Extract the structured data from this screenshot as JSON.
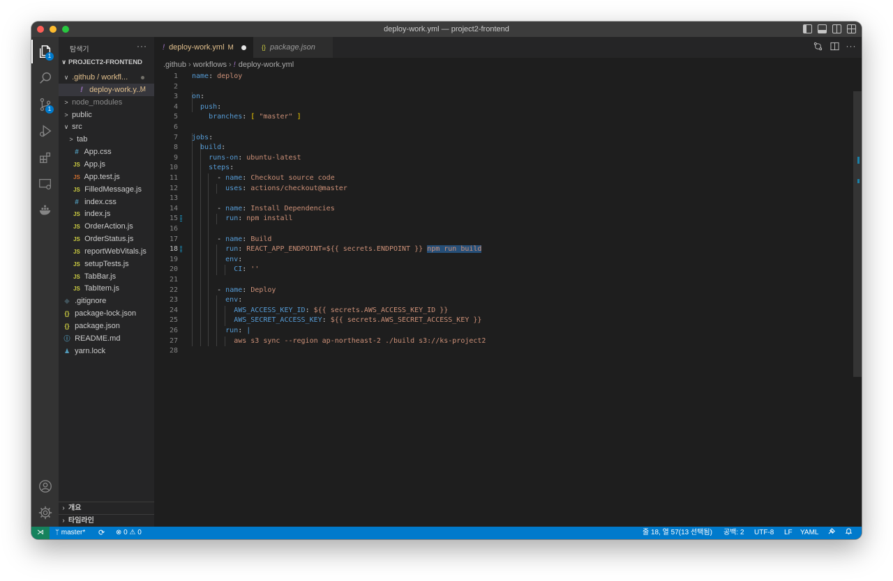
{
  "window": {
    "title": "deploy-work.yml — project2-frontend"
  },
  "activity_bar": {
    "explorer_badge": "1",
    "scm_badge": "1"
  },
  "sidebar": {
    "header": "탐색기",
    "more": "···",
    "project": "PROJECT2-FRONTEND",
    "tree": [
      {
        "label": ".github / workfl...",
        "chevron": "∨",
        "indent": 1,
        "kind": "folder",
        "modified_dot": true
      },
      {
        "label": "deploy-work.y...",
        "indent": 2,
        "kind": "yml",
        "icon": "!",
        "status": "M",
        "selected": true
      },
      {
        "label": "node_modules",
        "chevron": ">",
        "indent": 1,
        "kind": "folder-dim"
      },
      {
        "label": "public",
        "chevron": ">",
        "indent": 1,
        "kind": "folder"
      },
      {
        "label": "src",
        "chevron": "∨",
        "indent": 1,
        "kind": "folder"
      },
      {
        "label": "tab",
        "chevron": ">",
        "indent": 2,
        "kind": "folder"
      },
      {
        "label": "App.css",
        "indent": 2,
        "kind": "css",
        "icon": "#"
      },
      {
        "label": "App.js",
        "indent": 2,
        "kind": "js",
        "icon": "JS"
      },
      {
        "label": "App.test.js",
        "indent": 2,
        "kind": "js-red",
        "icon": "JS"
      },
      {
        "label": "FilledMessage.js",
        "indent": 2,
        "kind": "js",
        "icon": "JS"
      },
      {
        "label": "index.css",
        "indent": 2,
        "kind": "css",
        "icon": "#"
      },
      {
        "label": "index.js",
        "indent": 2,
        "kind": "js",
        "icon": "JS"
      },
      {
        "label": "OrderAction.js",
        "indent": 2,
        "kind": "js",
        "icon": "JS"
      },
      {
        "label": "OrderStatus.js",
        "indent": 2,
        "kind": "js",
        "icon": "JS"
      },
      {
        "label": "reportWebVitals.js",
        "indent": 2,
        "kind": "js",
        "icon": "JS"
      },
      {
        "label": "setupTests.js",
        "indent": 2,
        "kind": "js",
        "icon": "JS"
      },
      {
        "label": "TabBar.js",
        "indent": 2,
        "kind": "js",
        "icon": "JS"
      },
      {
        "label": "TabItem.js",
        "indent": 2,
        "kind": "js",
        "icon": "JS"
      },
      {
        "label": ".gitignore",
        "indent": 1,
        "kind": "git",
        "icon": "◆"
      },
      {
        "label": "package-lock.json",
        "indent": 1,
        "kind": "json",
        "icon": "{}"
      },
      {
        "label": "package.json",
        "indent": 1,
        "kind": "json",
        "icon": "{}"
      },
      {
        "label": "README.md",
        "indent": 1,
        "kind": "info",
        "icon": "ⓘ"
      },
      {
        "label": "yarn.lock",
        "indent": 1,
        "kind": "yarn",
        "icon": "♟"
      }
    ],
    "sections": [
      {
        "label": "개요"
      },
      {
        "label": "타임라인"
      }
    ]
  },
  "tabs": [
    {
      "icon": "!",
      "label": "deploy-work.yml",
      "status": "M",
      "active": true
    },
    {
      "icon": "{}",
      "label": "package.json",
      "active": false
    }
  ],
  "breadcrumb": [
    ".github",
    "workflows",
    "deploy-work.yml"
  ],
  "editor": {
    "current_line": 18,
    "lines": [
      [
        {
          "t": "name",
          "c": "k"
        },
        {
          "t": ": ",
          "c": "p"
        },
        {
          "t": "deploy",
          "c": "s"
        }
      ],
      [],
      [
        {
          "t": "on",
          "c": "k"
        },
        {
          "t": ":",
          "c": "p"
        }
      ],
      [
        {
          "t": "  push",
          "c": "k"
        },
        {
          "t": ":",
          "c": "p"
        }
      ],
      [
        {
          "t": "    branches",
          "c": "k"
        },
        {
          "t": ": ",
          "c": "p"
        },
        {
          "t": "[",
          "c": "br"
        },
        {
          "t": " ",
          "c": "p"
        },
        {
          "t": "\"master\"",
          "c": "s"
        },
        {
          "t": " ",
          "c": "p"
        },
        {
          "t": "]",
          "c": "br"
        }
      ],
      [],
      [
        {
          "t": "jobs",
          "c": "k"
        },
        {
          "t": ":",
          "c": "p"
        }
      ],
      [
        {
          "t": "  build",
          "c": "k"
        },
        {
          "t": ":",
          "c": "p"
        }
      ],
      [
        {
          "t": "    runs-on",
          "c": "k"
        },
        {
          "t": ": ",
          "c": "p"
        },
        {
          "t": "ubuntu-latest",
          "c": "s"
        }
      ],
      [
        {
          "t": "    steps",
          "c": "k"
        },
        {
          "t": ":",
          "c": "p"
        }
      ],
      [
        {
          "t": "      - ",
          "c": "p"
        },
        {
          "t": "name",
          "c": "k"
        },
        {
          "t": ": ",
          "c": "p"
        },
        {
          "t": "Checkout source code",
          "c": "s"
        }
      ],
      [
        {
          "t": "        uses",
          "c": "k"
        },
        {
          "t": ": ",
          "c": "p"
        },
        {
          "t": "actions/checkout@master",
          "c": "s"
        }
      ],
      [],
      [
        {
          "t": "      - ",
          "c": "p"
        },
        {
          "t": "name",
          "c": "k"
        },
        {
          "t": ": ",
          "c": "p"
        },
        {
          "t": "Install Dependencies",
          "c": "s"
        }
      ],
      [
        {
          "t": "        run",
          "c": "k"
        },
        {
          "t": ": ",
          "c": "p"
        },
        {
          "t": "npm install",
          "c": "s"
        }
      ],
      [],
      [
        {
          "t": "      - ",
          "c": "p"
        },
        {
          "t": "name",
          "c": "k"
        },
        {
          "t": ": ",
          "c": "p"
        },
        {
          "t": "Build",
          "c": "s"
        }
      ],
      [
        {
          "t": "        run",
          "c": "k"
        },
        {
          "t": ": ",
          "c": "p"
        },
        {
          "t": "REACT_APP_ENDPOINT=${{ secrets.ENDPOINT }} ",
          "c": "s"
        },
        {
          "t": "npm run build",
          "c": "s sel"
        }
      ],
      [
        {
          "t": "        env",
          "c": "k"
        },
        {
          "t": ":",
          "c": "p"
        }
      ],
      [
        {
          "t": "          CI",
          "c": "k"
        },
        {
          "t": ": ",
          "c": "p"
        },
        {
          "t": "''",
          "c": "s"
        }
      ],
      [],
      [
        {
          "t": "      - ",
          "c": "p"
        },
        {
          "t": "name",
          "c": "k"
        },
        {
          "t": ": ",
          "c": "p"
        },
        {
          "t": "Deploy",
          "c": "s"
        }
      ],
      [
        {
          "t": "        env",
          "c": "k"
        },
        {
          "t": ":",
          "c": "p"
        }
      ],
      [
        {
          "t": "          AWS_ACCESS_KEY_ID",
          "c": "k"
        },
        {
          "t": ": ",
          "c": "p"
        },
        {
          "t": "${{ secrets.AWS_ACCESS_KEY_ID }}",
          "c": "s"
        }
      ],
      [
        {
          "t": "          AWS_SECRET_ACCESS_KEY",
          "c": "k"
        },
        {
          "t": ": ",
          "c": "p"
        },
        {
          "t": "${{ secrets.AWS_SECRET_ACCESS_KEY }}",
          "c": "s"
        }
      ],
      [
        {
          "t": "        run",
          "c": "k"
        },
        {
          "t": ": ",
          "c": "p"
        },
        {
          "t": "|",
          "c": "k"
        }
      ],
      [
        {
          "t": "          aws s3 sync --region ap-northeast-2 ./build s3://ks-project2",
          "c": "s"
        }
      ],
      []
    ]
  },
  "statusbar": {
    "remote": "⋊",
    "branch": "master*",
    "sync": "⟳",
    "errors": "0",
    "warnings": "0",
    "position": "줄 18, 열 57(13 선택됨)",
    "spaces": "공백: 2",
    "encoding": "UTF-8",
    "eol": "LF",
    "language": "YAML"
  },
  "colors": {
    "accent": "#007acc",
    "yaml_key": "#569cd6",
    "yaml_string": "#ce9178",
    "modified": "#e2c08d"
  }
}
